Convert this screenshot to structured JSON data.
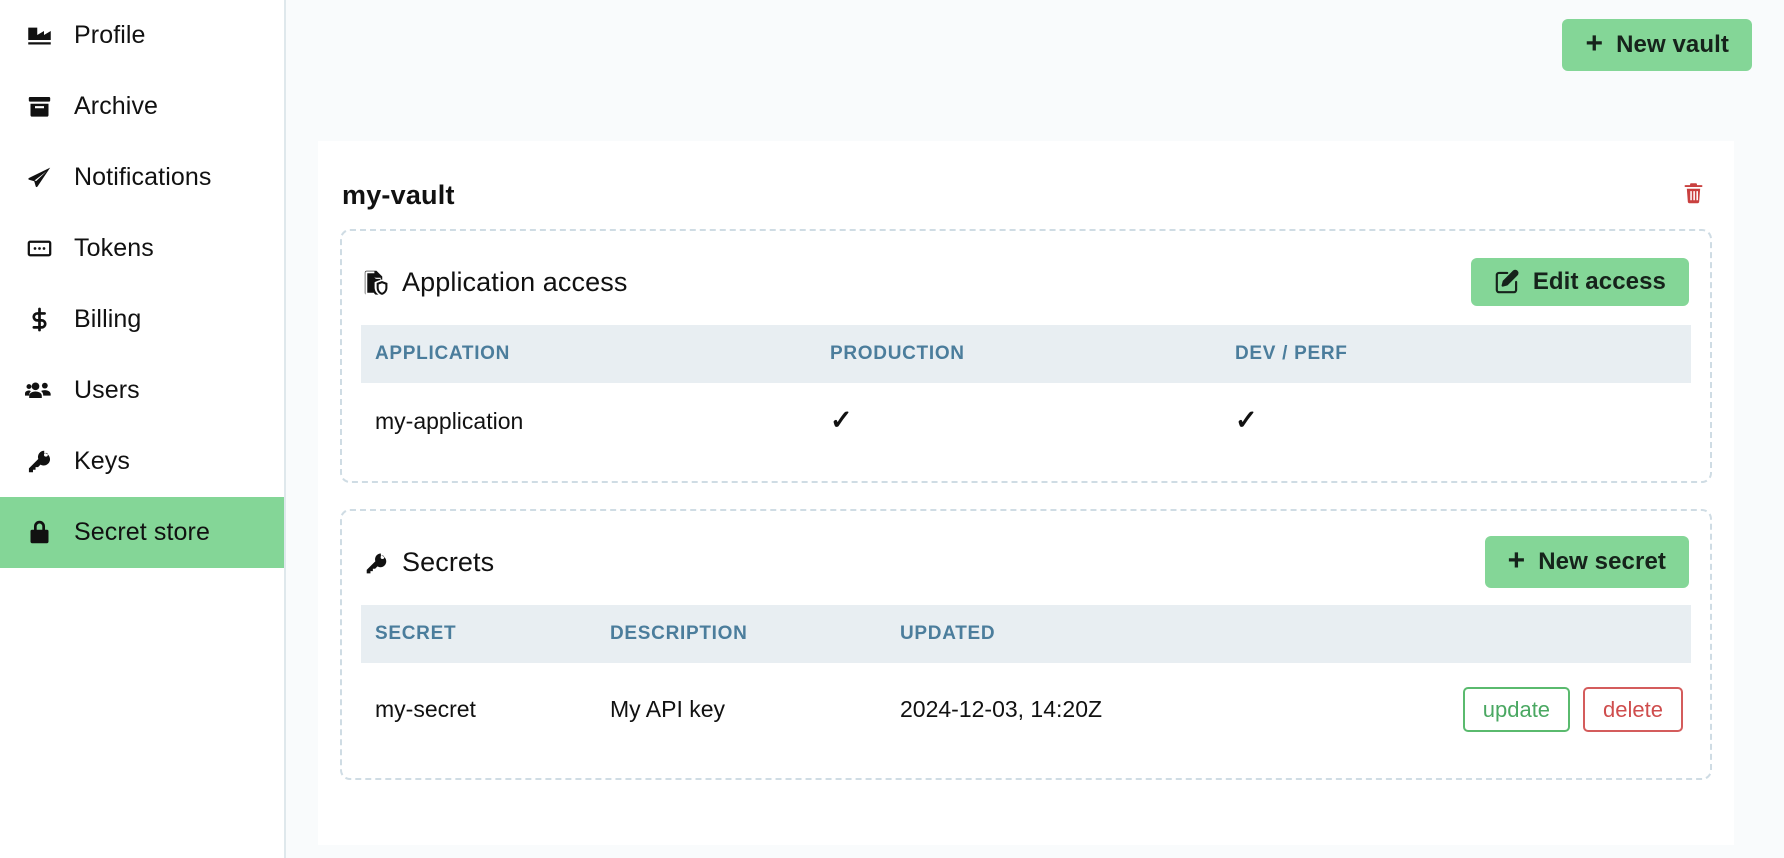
{
  "sidebar": {
    "items": [
      {
        "label": "Profile",
        "icon": "factory-icon",
        "active": false
      },
      {
        "label": "Archive",
        "icon": "archive-box-icon",
        "active": false
      },
      {
        "label": "Notifications",
        "icon": "paper-plane-icon",
        "active": false
      },
      {
        "label": "Tokens",
        "icon": "token-card-icon",
        "active": false
      },
      {
        "label": "Billing",
        "icon": "dollar-sign-icon",
        "active": false
      },
      {
        "label": "Users",
        "icon": "users-group-icon",
        "active": false
      },
      {
        "label": "Keys",
        "icon": "key-icon",
        "active": false
      },
      {
        "label": "Secret store",
        "icon": "lock-icon",
        "active": true
      }
    ]
  },
  "topbar": {
    "new_vault_label": "New vault",
    "new_vault_plus": "+"
  },
  "vault": {
    "name": "my-vault",
    "delete_icon": "trash-icon"
  },
  "application_access": {
    "title": "Application access",
    "icon": "file-shield-icon",
    "edit_button": "Edit access",
    "columns": [
      "APPLICATION",
      "PRODUCTION",
      "DEV / PERF"
    ],
    "rows": [
      {
        "application": "my-application",
        "production": "✓",
        "dev_perf": "✓"
      }
    ]
  },
  "secrets": {
    "title": "Secrets",
    "icon": "key-icon",
    "new_button": "New secret",
    "new_button_plus": "+",
    "columns": [
      "SECRET",
      "DESCRIPTION",
      "UPDATED"
    ],
    "rows": [
      {
        "secret": "my-secret",
        "description": "My API key",
        "updated": "2024-12-03, 14:20Z",
        "update_label": "update",
        "delete_label": "delete"
      }
    ]
  },
  "colors": {
    "accent_green": "#84d697",
    "danger_red": "#c9403f",
    "update_green": "#4aa862",
    "table_header_bg": "#e8eef2",
    "table_header_text": "#4b7d9c",
    "page_bg": "#f9fbfc",
    "dashed_border": "#cfdce4"
  }
}
